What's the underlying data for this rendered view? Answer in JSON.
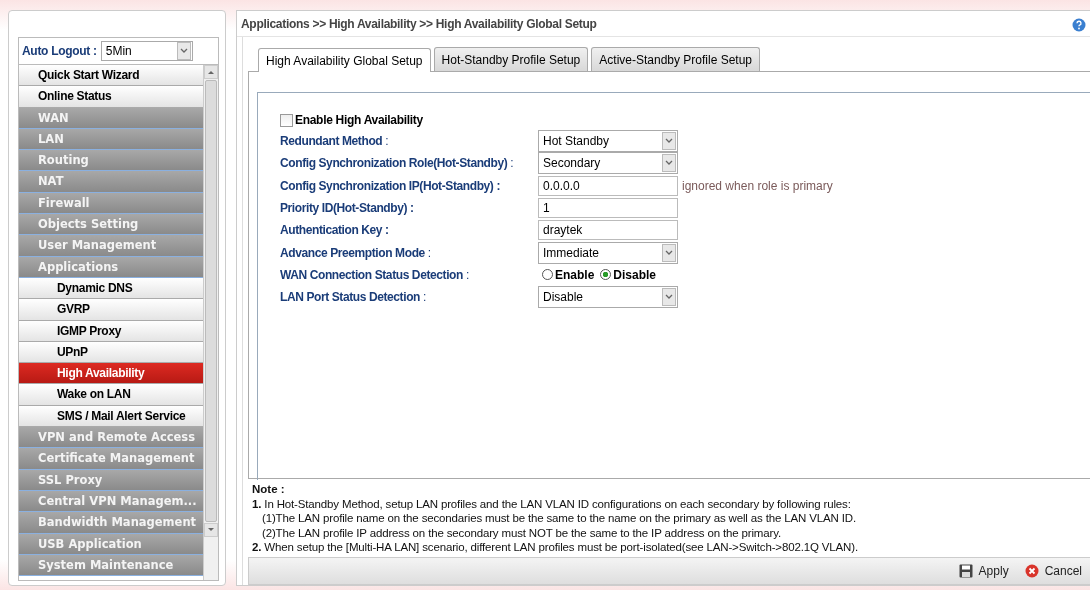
{
  "sidebar": {
    "auto_logout": {
      "label": "Auto Logout :",
      "value": "5Min"
    },
    "items": [
      {
        "label": "Quick Start Wizard",
        "kind": "link",
        "selected": false
      },
      {
        "label": "Online Status",
        "kind": "link",
        "selected": false
      },
      {
        "label": "WAN",
        "kind": "group",
        "selected": false
      },
      {
        "label": "LAN",
        "kind": "group",
        "selected": false
      },
      {
        "label": "Routing",
        "kind": "group",
        "selected": false
      },
      {
        "label": "NAT",
        "kind": "group",
        "selected": false
      },
      {
        "label": "Firewall",
        "kind": "group",
        "selected": false
      },
      {
        "label": "Objects Setting",
        "kind": "group",
        "selected": false
      },
      {
        "label": "User Management",
        "kind": "group",
        "selected": false
      },
      {
        "label": "Applications",
        "kind": "group",
        "selected": false
      },
      {
        "label": "Dynamic DNS",
        "kind": "sub",
        "selected": false
      },
      {
        "label": "GVRP",
        "kind": "sub",
        "selected": false
      },
      {
        "label": "IGMP Proxy",
        "kind": "sub",
        "selected": false
      },
      {
        "label": "UPnP",
        "kind": "sub",
        "selected": false
      },
      {
        "label": "High Availability",
        "kind": "sub",
        "selected": true
      },
      {
        "label": "Wake on LAN",
        "kind": "sub",
        "selected": false
      },
      {
        "label": "SMS / Mail Alert Service",
        "kind": "sub",
        "selected": false
      },
      {
        "label": "VPN and Remote Access",
        "kind": "group",
        "selected": false
      },
      {
        "label": "Certificate Management",
        "kind": "group",
        "selected": false
      },
      {
        "label": "SSL Proxy",
        "kind": "group",
        "selected": false
      },
      {
        "label": "Central VPN Managem...",
        "kind": "group",
        "selected": false
      },
      {
        "label": "Bandwidth Management",
        "kind": "group",
        "selected": false
      },
      {
        "label": "USB Application",
        "kind": "group",
        "selected": false
      },
      {
        "label": "System Maintenance",
        "kind": "group",
        "selected": false
      }
    ]
  },
  "breadcrumb": "Applications >> High Availability >> High Availability Global Setup",
  "tabs": [
    {
      "label": "High Availability Global Setup",
      "selected": true
    },
    {
      "label": "Hot-Standby Profile Setup",
      "selected": false
    },
    {
      "label": "Active-Standby Profile Setup",
      "selected": false
    }
  ],
  "enable": {
    "label": "Enable High Availability",
    "checked": false
  },
  "fields": [
    {
      "kind": "select",
      "label": "Redundant Method",
      "colon": ":",
      "value": "Hot Standby"
    },
    {
      "kind": "select",
      "label": "Config Synchronization Role(Hot-Standby)",
      "colon": ":",
      "value": "Secondary"
    },
    {
      "kind": "text",
      "label": "Config Synchronization IP(Hot-Standby) :",
      "value": "0.0.0.0",
      "hint": "ignored when role is primary"
    },
    {
      "kind": "text",
      "label": "Priority ID(Hot-Standby) :",
      "value": "1"
    },
    {
      "kind": "text",
      "label": "Authentication Key :",
      "value": "draytek"
    },
    {
      "kind": "select",
      "label": "Advance Preemption Mode",
      "colon": ":",
      "value": "Immediate"
    },
    {
      "kind": "radio",
      "label": "WAN Connection Status Detection",
      "colon": ":",
      "options": [
        {
          "label": "Enable",
          "selected": false
        },
        {
          "label": "Disable",
          "selected": true
        }
      ]
    },
    {
      "kind": "select",
      "label": "LAN Port Status Detection",
      "colon": ":",
      "value": "Disable"
    }
  ],
  "note": {
    "title": "Note :",
    "lines": [
      {
        "text": "**1.** In Hot-Standby Method, setup LAN profiles and the LAN VLAN ID configurations on each secondary by following rules:",
        "indent": false
      },
      {
        "text": "(1)The LAN profile name on the secondaries must be the same to the name on the primary as well as the LAN VLAN ID.",
        "indent": true
      },
      {
        "text": "(2)The LAN profile IP address on the secondary must NOT be the same to the IP address on the primary.",
        "indent": true
      },
      {
        "text": "**2.** When setup the [Multi-HA LAN] scenario, different LAN profiles must be port-isolated(see LAN->Switch->802.1Q VLAN).",
        "indent": false
      }
    ]
  },
  "buttons": [
    {
      "kind": "apply",
      "label": "Apply"
    },
    {
      "kind": "cancel",
      "label": "Cancel"
    }
  ]
}
